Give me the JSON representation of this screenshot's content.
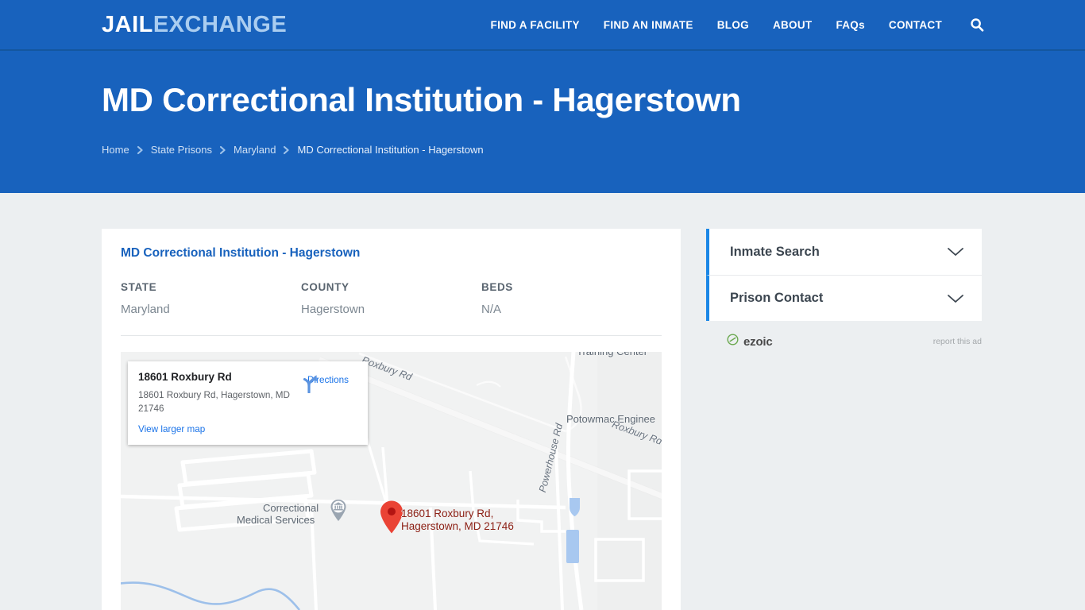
{
  "site": {
    "logo_part1": "JAIL",
    "logo_part2": "EXCHANGE",
    "brand_blue": "#1862bd",
    "accent_blue": "#1b87e6",
    "page_bg": "#eceff1"
  },
  "nav": {
    "items": [
      {
        "label": "FIND A FACILITY"
      },
      {
        "label": "FIND AN INMATE"
      },
      {
        "label": "BLOG"
      },
      {
        "label": "ABOUT"
      },
      {
        "label": "FAQs"
      },
      {
        "label": "CONTACT"
      }
    ],
    "search_icon": "search-icon"
  },
  "hero": {
    "title": "MD Correctional Institution - Hagerstown",
    "breadcrumb": [
      {
        "label": "Home",
        "current": false
      },
      {
        "label": "State Prisons",
        "current": false
      },
      {
        "label": "Maryland",
        "current": false
      },
      {
        "label": "MD Correctional Institution - Hagerstown",
        "current": true
      }
    ],
    "separator_icon": "chevron-right-icon"
  },
  "facility": {
    "name": "MD Correctional Institution - Hagerstown",
    "facts": [
      {
        "label": "STATE",
        "value": "Maryland"
      },
      {
        "label": "COUNTY",
        "value": "Hagerstown"
      },
      {
        "label": "BEDS",
        "value": "N/A"
      }
    ]
  },
  "map": {
    "info_card": {
      "title": "18601 Roxbury Rd",
      "address": "18601 Roxbury Rd, Hagerstown, MD 21746",
      "view_larger": "View larger map",
      "directions_label": "Directions",
      "directions_icon": "directions-fork-icon"
    },
    "pin_icon": "map-pin-icon",
    "pin_label_line1": "18601 Roxbury Rd,",
    "pin_label_line2": "Hagerstown, MD 21746",
    "poi_icon": "museum-marker-icon",
    "labels": [
      {
        "text": "Training Center",
        "kind": "place"
      },
      {
        "text": "Potowmac Enginee",
        "kind": "place"
      },
      {
        "text": "Correctional",
        "kind": "place"
      },
      {
        "text": "Medical Services",
        "kind": "place"
      },
      {
        "text": "Roxbury Rd",
        "kind": "road"
      },
      {
        "text": "Roxbury Rd",
        "kind": "road"
      },
      {
        "text": "Powerhouse Rd",
        "kind": "road"
      }
    ]
  },
  "sidebar": {
    "panels": [
      {
        "title": "Inmate Search",
        "chevron": "chevron-down-icon"
      },
      {
        "title": "Prison Contact",
        "chevron": "chevron-down-icon"
      }
    ],
    "ad": {
      "provider": "ezoic",
      "logo_icon": "ezoic-logo-icon",
      "report_label": "report this ad",
      "logo_color": "#6aa84f"
    }
  }
}
